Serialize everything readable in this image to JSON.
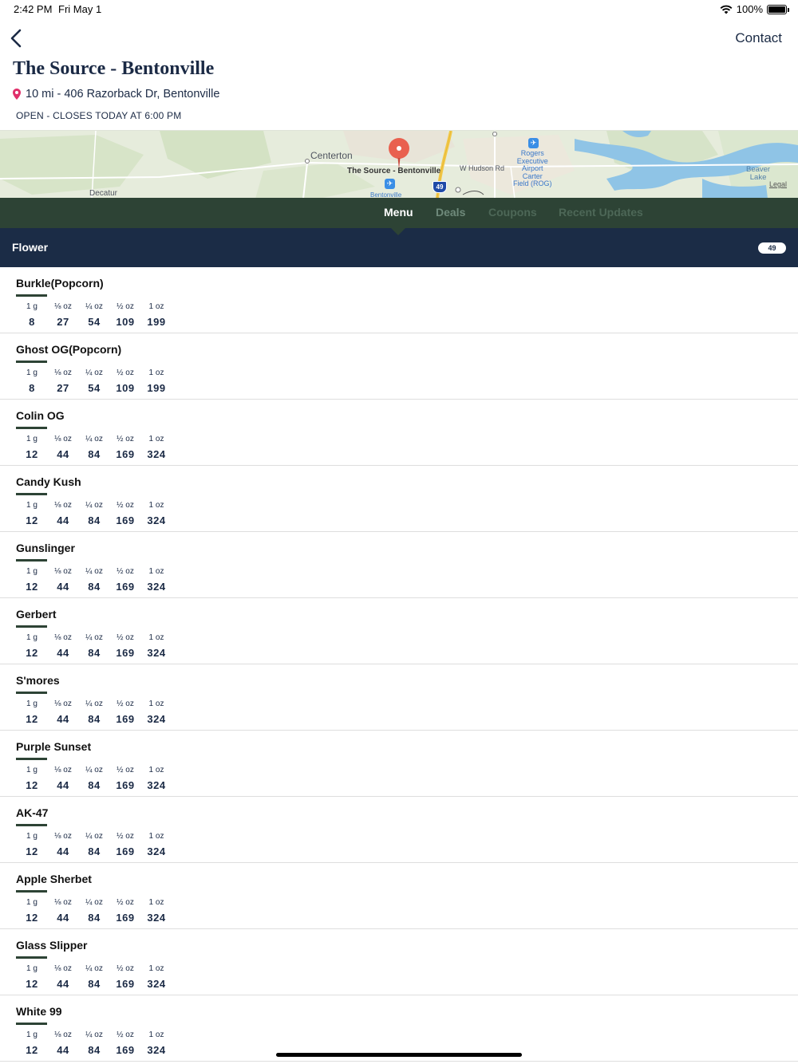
{
  "status_bar": {
    "time": "2:42 PM",
    "date": "Fri May 1",
    "battery": "100%"
  },
  "nav": {
    "contact_label": "Contact"
  },
  "store": {
    "name": "The Source - Bentonville",
    "address": "10 mi - 406 Razorback Dr, Bentonville",
    "hours": "OPEN - CLOSES TODAY AT 6:00 PM"
  },
  "map": {
    "labels": {
      "centerton": "Centerton",
      "pin": "The Source - Bentonville",
      "hudson": "W Hudson Rd",
      "airport": "Rogers\nExecutive\nAirport\nCarter\nField (ROG)",
      "beaver": "Beaver\nLake",
      "decatur": "Decatur",
      "bentonville": "Bentonville",
      "interstate": "49",
      "legal": "Legal"
    }
  },
  "tabs": [
    {
      "label": "Menu",
      "active": true
    },
    {
      "label": "Deals",
      "active": false
    },
    {
      "label": "Coupons",
      "active": false
    },
    {
      "label": "Recent Updates",
      "active": false
    }
  ],
  "category": {
    "title": "Flower",
    "count": "49"
  },
  "price_units": [
    "1 g",
    "⅛ oz",
    "¼ oz",
    "½ oz",
    "1 oz"
  ],
  "products": [
    {
      "name": "Burkle(Popcorn)",
      "prices": [
        "8",
        "27",
        "54",
        "109",
        "199"
      ]
    },
    {
      "name": "Ghost OG(Popcorn)",
      "prices": [
        "8",
        "27",
        "54",
        "109",
        "199"
      ]
    },
    {
      "name": "Colin OG",
      "prices": [
        "12",
        "44",
        "84",
        "169",
        "324"
      ]
    },
    {
      "name": "Candy Kush",
      "prices": [
        "12",
        "44",
        "84",
        "169",
        "324"
      ]
    },
    {
      "name": "Gunslinger",
      "prices": [
        "12",
        "44",
        "84",
        "169",
        "324"
      ]
    },
    {
      "name": "Gerbert",
      "prices": [
        "12",
        "44",
        "84",
        "169",
        "324"
      ]
    },
    {
      "name": "S'mores",
      "prices": [
        "12",
        "44",
        "84",
        "169",
        "324"
      ]
    },
    {
      "name": "Purple Sunset",
      "prices": [
        "12",
        "44",
        "84",
        "169",
        "324"
      ]
    },
    {
      "name": "AK-47",
      "prices": [
        "12",
        "44",
        "84",
        "169",
        "324"
      ]
    },
    {
      "name": "Apple Sherbet",
      "prices": [
        "12",
        "44",
        "84",
        "169",
        "324"
      ]
    },
    {
      "name": "Glass Slipper",
      "prices": [
        "12",
        "44",
        "84",
        "169",
        "324"
      ]
    },
    {
      "name": "White 99",
      "prices": [
        "12",
        "44",
        "84",
        "169",
        "324"
      ]
    }
  ],
  "colors": {
    "tab_bar": "#2d4335",
    "category_bar": "#1b2c46",
    "text_primary": "#1b2a45",
    "pin": "#e9604f",
    "tab_active": "#ffffff",
    "tab_inactive": "#6f8a7b",
    "tab_muted": "#4d6757"
  }
}
